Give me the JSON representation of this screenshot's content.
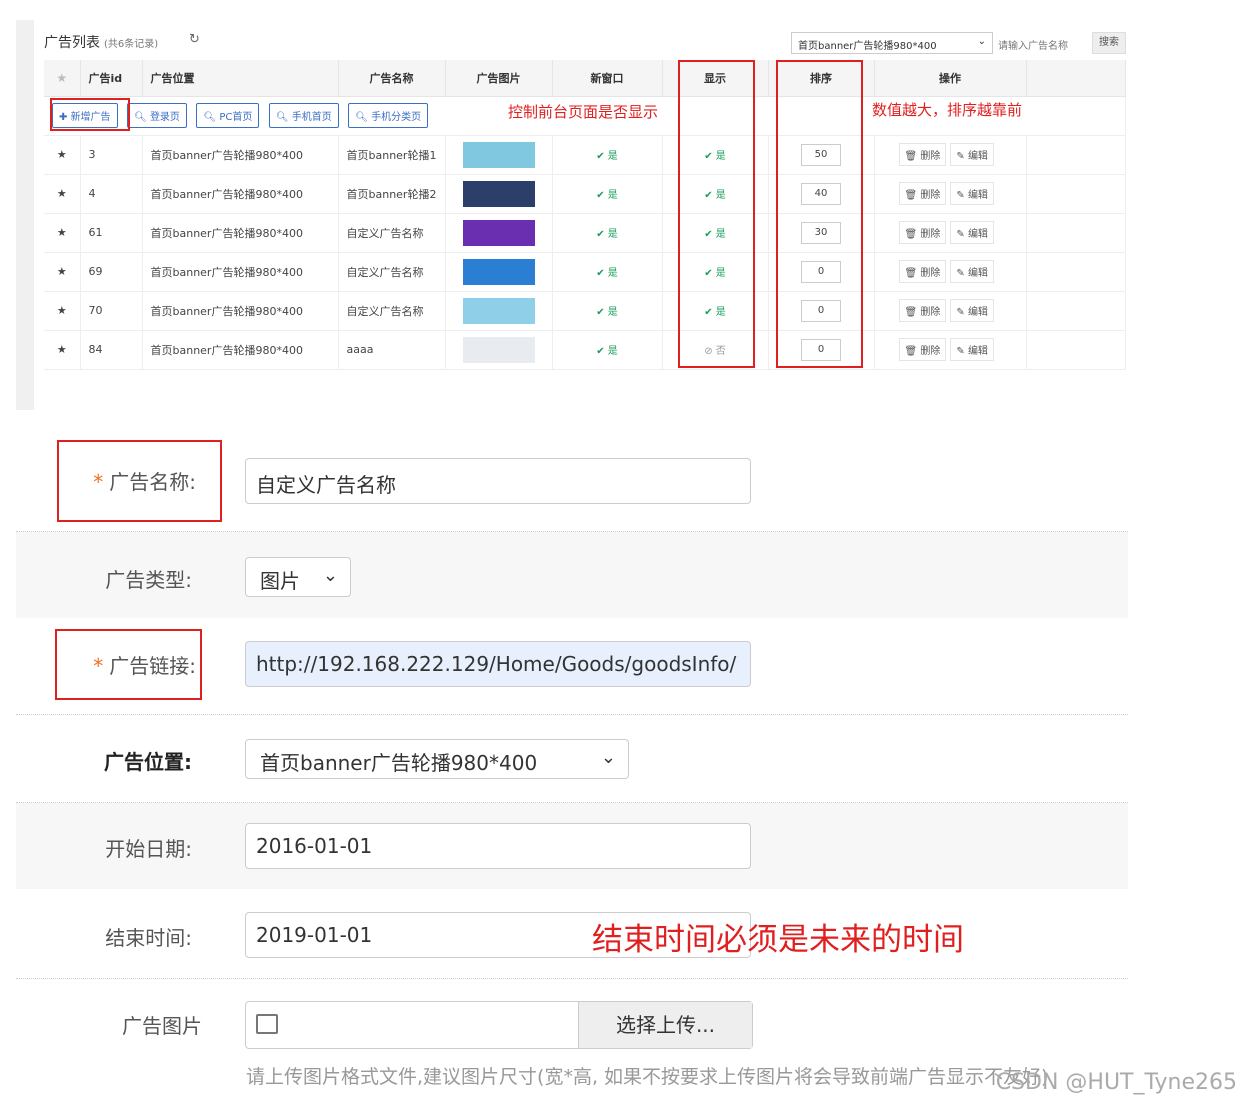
{
  "list": {
    "title": "广告列表",
    "count_text": "(共6条记录)",
    "position_select": "首页banner广告轮播980*400",
    "search_placeholder": "请输入广告名称",
    "search_btn": "搜索",
    "headers": [
      "",
      "广告id",
      "广告位置",
      "广告名称",
      "广告图片",
      "新窗口",
      "显示",
      "排序",
      "操作"
    ],
    "toolbar": [
      "新增广告",
      "登录页",
      "PC首页",
      "手机首页",
      "手机分类页"
    ],
    "rows": [
      {
        "id": "3",
        "pos": "首页banner广告轮播980*400",
        "name": "首页banner轮播1",
        "newwin": "是",
        "show": "是",
        "sort": "50"
      },
      {
        "id": "4",
        "pos": "首页banner广告轮播980*400",
        "name": "首页banner轮播2",
        "newwin": "是",
        "show": "是",
        "sort": "40"
      },
      {
        "id": "61",
        "pos": "首页banner广告轮播980*400",
        "name": "自定义广告名称",
        "newwin": "是",
        "show": "是",
        "sort": "30"
      },
      {
        "id": "69",
        "pos": "首页banner广告轮播980*400",
        "name": "自定义广告名称",
        "newwin": "是",
        "show": "是",
        "sort": "0"
      },
      {
        "id": "70",
        "pos": "首页banner广告轮播980*400",
        "name": "自定义广告名称",
        "newwin": "是",
        "show": "是",
        "sort": "0"
      },
      {
        "id": "84",
        "pos": "首页banner广告轮播980*400",
        "name": "aaaa",
        "newwin": "是",
        "show": "否",
        "sort": "0"
      }
    ],
    "op_delete": "删除",
    "op_edit": "编辑",
    "annotation_show": "控制前台页面是否显示",
    "annotation_sort": "数值越大，排序越靠前"
  },
  "form": {
    "name_label": "广告名称:",
    "name_value": "自定义广告名称",
    "type_label": "广告类型:",
    "type_value": "图片",
    "link_label": "广告链接:",
    "link_value": "http://192.168.222.129/Home/Goods/goodsInfo/",
    "pos_label": "广告位置:",
    "pos_value": "首页banner广告轮播980*400",
    "start_label": "开始日期:",
    "start_value": "2016-01-01",
    "end_label": "结束时间:",
    "end_value": "2019-01-01",
    "end_annotation": "结束时间必须是未来的时间",
    "image_label": "广告图片",
    "upload_btn": "选择上传...",
    "hint": "请上传图片格式文件,建议图片尺寸(宽*高, 如果不按要求上传图片将会导致前端广告显示不友好)",
    "req_mark": "*"
  },
  "watermark": "CSDN @HUT_Tyne265",
  "colors": {
    "accent": "#3a6fc4",
    "annotation": "#e02020",
    "ok": "#1a9c5a",
    "required": "#f07020"
  },
  "thumb_colors": [
    "#7fc8e0",
    "#2c3e6a",
    "#6a2fb0",
    "#2a7fd4",
    "#8fd0e8",
    "#e8ecf0"
  ]
}
